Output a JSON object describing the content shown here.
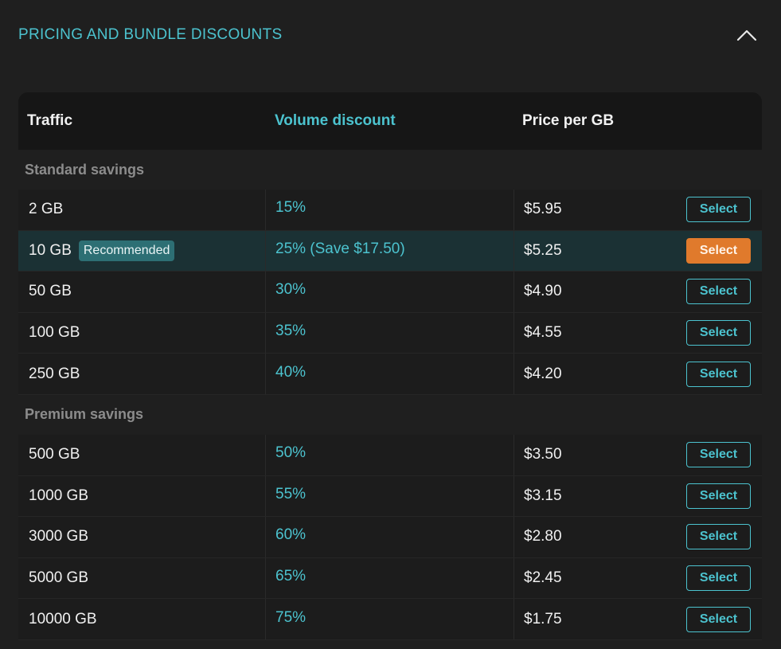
{
  "section": {
    "title": "PRICING AND BUNDLE DISCOUNTS"
  },
  "table": {
    "headers": {
      "traffic": "Traffic",
      "discount": "Volume discount",
      "price": "Price per GB"
    },
    "select_label": "Select",
    "groups": [
      {
        "label": "Standard savings",
        "rows": [
          {
            "traffic": "2 GB",
            "badge": "",
            "discount": "15%",
            "price": "$5.95",
            "selected": false
          },
          {
            "traffic": "10 GB",
            "badge": "Recommended",
            "discount": "25% (Save $17.50)",
            "price": "$5.25",
            "selected": true
          },
          {
            "traffic": "50 GB",
            "badge": "",
            "discount": "30%",
            "price": "$4.90",
            "selected": false
          },
          {
            "traffic": "100 GB",
            "badge": "",
            "discount": "35%",
            "price": "$4.55",
            "selected": false
          },
          {
            "traffic": "250 GB",
            "badge": "",
            "discount": "40%",
            "price": "$4.20",
            "selected": false
          }
        ]
      },
      {
        "label": "Premium savings",
        "rows": [
          {
            "traffic": "500 GB",
            "badge": "",
            "discount": "50%",
            "price": "$3.50",
            "selected": false
          },
          {
            "traffic": "1000 GB",
            "badge": "",
            "discount": "55%",
            "price": "$3.15",
            "selected": false
          },
          {
            "traffic": "3000 GB",
            "badge": "",
            "discount": "60%",
            "price": "$2.80",
            "selected": false
          },
          {
            "traffic": "5000 GB",
            "badge": "",
            "discount": "65%",
            "price": "$2.45",
            "selected": false
          },
          {
            "traffic": "10000 GB",
            "badge": "",
            "discount": "75%",
            "price": "$1.75",
            "selected": false
          }
        ]
      }
    ]
  },
  "colors": {
    "accent": "#4cc3cf",
    "selected_button": "#e07a2c",
    "highlight_row": "#1b3134",
    "background": "#1f1f1f"
  }
}
